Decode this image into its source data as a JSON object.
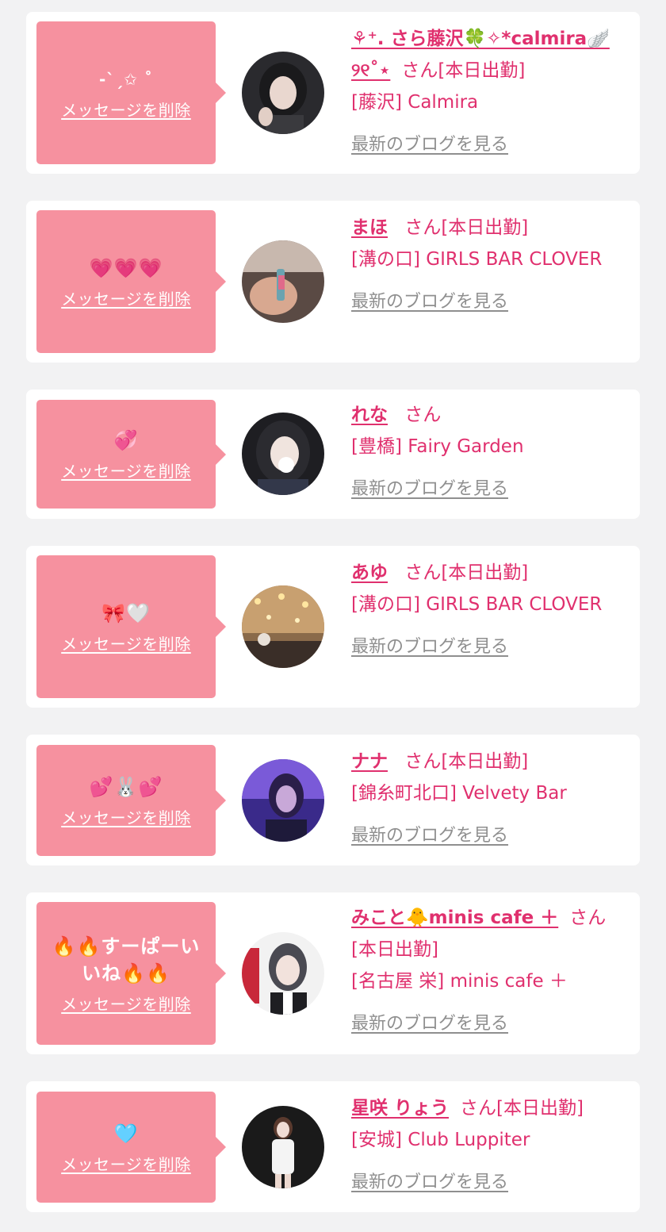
{
  "colors": {
    "background": "#f2f2f3",
    "card": "#ffffff",
    "bubble": "#f6919f",
    "accent": "#e0306e",
    "link_gray": "#8f8f8f"
  },
  "entries": [
    {
      "message": "-ˋˏ✩ ˚",
      "delete_label": "メッセージを削除",
      "name": "⚘⁺. さら藤沢🍀✧*calmira🪽୨୧˚⋆",
      "san": "さん",
      "status": "[本日出勤]",
      "shop": "[藤沢] Calmira",
      "blog_label": "最新のブログを見る",
      "avatar_icon": "avatar-photo-dark-hair"
    },
    {
      "message": "💗💗💗",
      "delete_label": "メッセージを削除",
      "name": "まほ",
      "san": "さん",
      "status": "[本日出勤]",
      "shop": "[溝の口] GIRLS BAR CLOVER",
      "blog_label": "最新のブログを見る",
      "avatar_icon": "avatar-photo-bar"
    },
    {
      "message": "💞",
      "delete_label": "メッセージを削除",
      "name": "れな",
      "san": "さん",
      "status": "",
      "shop": "[豊橋] Fairy Garden",
      "blog_label": "最新のブログを見る",
      "avatar_icon": "avatar-photo-rena"
    },
    {
      "message": "🎀🤍",
      "delete_label": "メッセージを削除",
      "name": "あゆ",
      "san": "さん",
      "status": "[本日出勤]",
      "shop": "[溝の口] GIRLS BAR CLOVER",
      "blog_label": "最新のブログを見る",
      "avatar_icon": "avatar-photo-lights"
    },
    {
      "message": "💕🐰💕",
      "delete_label": "メッセージを削除",
      "name": "ナナ",
      "san": "さん",
      "status": "[本日出勤]",
      "shop": "[錦糸町北口] Velvety Bar",
      "blog_label": "最新のブログを見る",
      "avatar_icon": "avatar-photo-purple"
    },
    {
      "message": "🔥🔥すーぱーいいね🔥🔥",
      "delete_label": "メッセージを削除",
      "name": "みこと🐥minis cafe ＋",
      "san": "さん",
      "status": "[本日出勤]",
      "shop": "[名古屋 栄] minis cafe ＋",
      "blog_label": "最新のブログを見る",
      "avatar_icon": "avatar-photo-white"
    },
    {
      "message": "🩵",
      "delete_label": "メッセージを削除",
      "name": "星咲 りょう",
      "san": "さん",
      "status": "[本日出勤]",
      "shop": "[安城] Club Luppiter",
      "blog_label": "最新のブログを見る",
      "avatar_icon": "avatar-photo-white-dress"
    }
  ]
}
